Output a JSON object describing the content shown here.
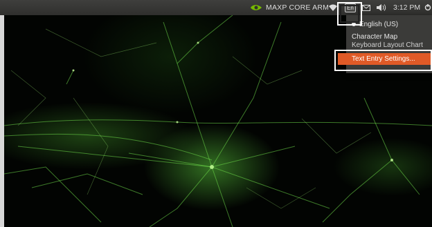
{
  "panel": {
    "machine_name": "MAXP CORE ARM",
    "keyboard_indicator": "En",
    "clock": "3:12 PM",
    "icons": [
      "nvidia-logo-icon",
      "wifi-icon",
      "keyboard-layout-icon",
      "mail-icon",
      "volume-icon",
      "power-gear-icon"
    ]
  },
  "keyboard_menu": {
    "items": [
      {
        "label": "English (US)",
        "selected": true
      },
      {
        "label": "Character Map"
      },
      {
        "label": "Keyboard Layout Chart"
      },
      {
        "label": "Text Entry Settings..."
      }
    ]
  },
  "colors": {
    "panel": "#3a3a38",
    "menu": "#3b3b39",
    "accent": "#e05a27",
    "wallpaper_glow": "#5ac83c"
  }
}
